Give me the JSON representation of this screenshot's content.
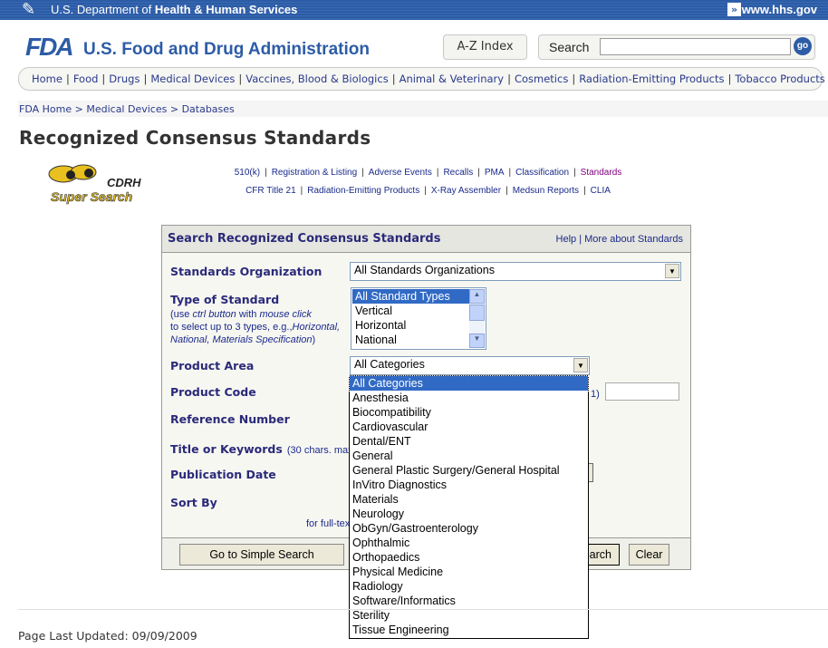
{
  "hhs": {
    "title_prefix": "U.S. Department of ",
    "title_bold": "Health & Human Services",
    "link": "www.hhs.gov"
  },
  "header": {
    "logo": "FDA",
    "agency": "U.S. Food and Drug Administration",
    "az_index": "A-Z Index",
    "search_label": "Search",
    "search_value": "",
    "go": "go"
  },
  "nav": [
    "Home",
    "Food",
    "Drugs",
    "Medical Devices",
    "Vaccines, Blood & Biologics",
    "Animal & Veterinary",
    "Cosmetics",
    "Radiation-Emitting Products",
    "Tobacco Products"
  ],
  "breadcrumb": [
    "FDA Home",
    "Medical Devices",
    "Databases"
  ],
  "page_title": "Recognized Consensus Standards",
  "cdrh_logo": "CDRH Super Search",
  "db_links_row1": [
    "510(k)",
    "Registration & Listing",
    "Adverse Events",
    "Recalls",
    "PMA",
    "Classification",
    "Standards"
  ],
  "db_links_row2": [
    "CFR Title 21",
    "Radiation-Emitting Products",
    "X-Ray Assembler",
    "Medsun Reports",
    "CLIA"
  ],
  "colors": {
    "active_link": "#800080",
    "selection": "#316ac5",
    "brand": "#2d5ca6"
  },
  "form": {
    "title": "Search Recognized Consensus Standards",
    "help": "Help",
    "more": "More about Standards",
    "org_label": "Standards Organization",
    "org_value": "All Standards Organizations",
    "type_label": "Type of Standard",
    "type_note1": "(use ",
    "type_note_ctrl": "ctrl button",
    "type_note_with": " with ",
    "type_note_mouse": "mouse click",
    "type_note2": "to select up to 3 types, e.g.,",
    "type_note_ex1": "Horizontal,",
    "type_note_ex2": "National, Materials Specification",
    "type_note_end": ")",
    "type_options": [
      "All Standard Types",
      "Vertical",
      "Horizontal",
      "National"
    ],
    "area_label": "Product Area",
    "area_value": "All Categories",
    "code_label": "Product Code",
    "code_hint": "1)",
    "code_value": "",
    "ref_label": "Reference Number",
    "kw_label": "Title or Keywords",
    "kw_note": "(30 chars. max)",
    "date_label": "Publication Date",
    "sort_label": "Sort By",
    "fulltext": "for full-tex",
    "simple_search": "Go to Simple Search",
    "search": "Search",
    "clear": "Clear"
  },
  "area_options": [
    "All Categories",
    "Anesthesia",
    "Biocompatibility",
    "Cardiovascular",
    "Dental/ENT",
    "General",
    "General Plastic Surgery/General Hospital",
    "InVitro Diagnostics",
    "Materials",
    "Neurology",
    "ObGyn/Gastroenterology",
    "Ophthalmic",
    "Orthopaedics",
    "Physical Medicine",
    "Radiology",
    "Software/Informatics",
    "Sterility",
    "Tissue Engineering"
  ],
  "footer": "Page Last Updated: 09/09/2009"
}
